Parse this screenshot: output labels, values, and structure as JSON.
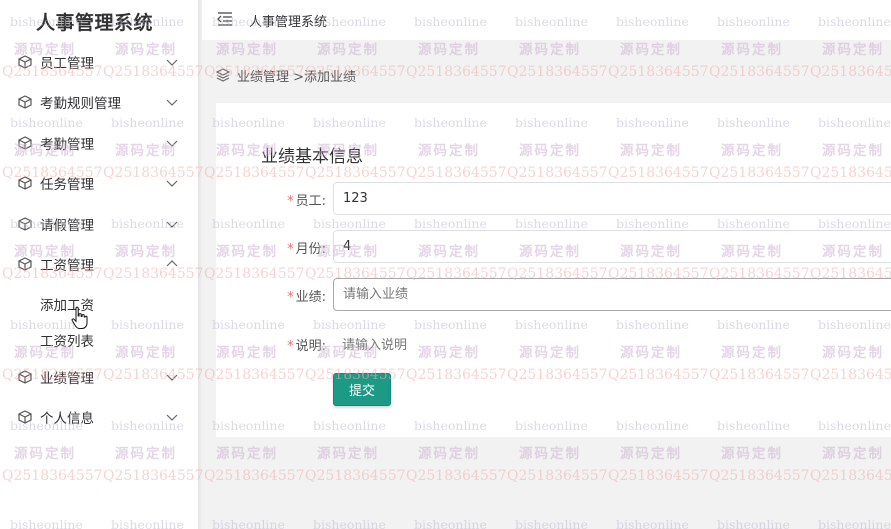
{
  "app": {
    "title": "人事管理系统"
  },
  "header": {
    "title": "人事管理系统"
  },
  "sidebar": {
    "items": [
      {
        "label": "员工管理",
        "icon": "cube-icon",
        "expanded": false
      },
      {
        "label": "考勤规则管理",
        "icon": "cube-icon",
        "expanded": false
      },
      {
        "label": "考勤管理",
        "icon": "cube-icon",
        "expanded": false
      },
      {
        "label": "任务管理",
        "icon": "cube-icon",
        "expanded": false
      },
      {
        "label": "请假管理",
        "icon": "cube-icon",
        "expanded": false
      },
      {
        "label": "工资管理",
        "icon": "cube-icon",
        "expanded": true
      },
      {
        "label": "业绩管理",
        "icon": "cube-icon",
        "expanded": false
      },
      {
        "label": "个人信息",
        "icon": "cube-icon",
        "expanded": false
      }
    ],
    "submenu": [
      "添加工资",
      "工资列表"
    ]
  },
  "breadcrumb": {
    "text": "业绩管理 >添加业绩"
  },
  "form": {
    "title": "业绩基本信息",
    "fields": [
      {
        "label": "员工:",
        "value": "123",
        "placeholder": ""
      },
      {
        "label": "月份:",
        "value": "4",
        "placeholder": ""
      },
      {
        "label": "业绩:",
        "value": "",
        "placeholder": "请输入业绩"
      },
      {
        "label": "说明:",
        "value": "",
        "placeholder": "请输入说明"
      }
    ],
    "required_mark": "*",
    "submit_label": "提交"
  },
  "watermark": {
    "line_a": "bisheonline",
    "line_b": "源码定制",
    "line_c": "Q2518364557"
  },
  "colors": {
    "accent": "#1c9a86",
    "required": "#f56c6c"
  }
}
